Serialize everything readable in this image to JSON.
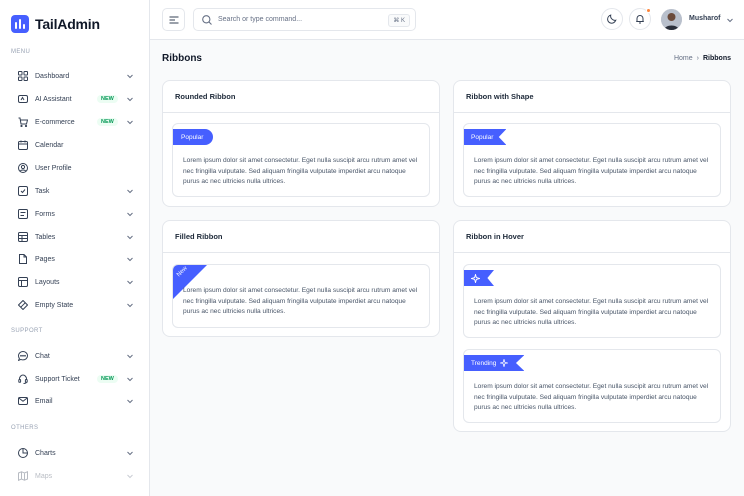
{
  "app": {
    "name": "TailAdmin"
  },
  "colors": {
    "accent": "#465fff",
    "badge_green": "#039855",
    "notif": "#fd853a"
  },
  "sidebar": {
    "sections": [
      {
        "label": "MENU"
      },
      {
        "label": "SUPPORT"
      },
      {
        "label": "OTHERS"
      }
    ],
    "items": [
      {
        "label": "Dashboard",
        "icon": "grid-icon",
        "chevron": true
      },
      {
        "label": "AI Assistant",
        "icon": "ai-icon",
        "badge": "NEW",
        "chevron": true
      },
      {
        "label": "E-commerce",
        "icon": "cart-icon",
        "badge": "NEW",
        "chevron": true
      },
      {
        "label": "Calendar",
        "icon": "calendar-icon"
      },
      {
        "label": "User Profile",
        "icon": "user-circle-icon"
      },
      {
        "label": "Task",
        "icon": "task-icon",
        "chevron": true
      },
      {
        "label": "Forms",
        "icon": "forms-icon",
        "chevron": true
      },
      {
        "label": "Tables",
        "icon": "table-icon",
        "chevron": true
      },
      {
        "label": "Pages",
        "icon": "pages-icon",
        "chevron": true
      },
      {
        "label": "Layouts",
        "icon": "layout-icon",
        "chevron": true
      },
      {
        "label": "Empty State",
        "icon": "empty-state-icon",
        "chevron": true
      },
      {
        "label": "Chat",
        "icon": "chat-icon",
        "chevron": true
      },
      {
        "label": "Support Ticket",
        "icon": "headset-icon",
        "badge": "NEW",
        "chevron": true
      },
      {
        "label": "Email",
        "icon": "mail-icon",
        "chevron": true
      },
      {
        "label": "Charts",
        "icon": "pie-chart-icon",
        "chevron": true
      },
      {
        "label": "Maps",
        "icon": "map-icon",
        "chevron": true
      }
    ]
  },
  "header": {
    "search_placeholder": "Search or type command...",
    "shortcut": "⌘ K",
    "user_name": "Musharof"
  },
  "page": {
    "title": "Ribbons",
    "breadcrumb_home": "Home",
    "breadcrumb_sep": "›",
    "breadcrumb_current": "Ribbons"
  },
  "cards": {
    "rounded": {
      "title": "Rounded Ribbon",
      "ribbon": "Popular"
    },
    "shape": {
      "title": "Ribbon with Shape",
      "ribbon": "Popular"
    },
    "filled": {
      "title": "Filled Ribbon",
      "ribbon": "New"
    },
    "hover": {
      "title": "Ribbon in Hover",
      "ribbon2": "Trending"
    }
  },
  "lorem": "Lorem ipsum dolor sit amet consectetur. Eget nulla suscipit arcu rutrum amet vel nec fringilla vulputate. Sed aliquam fringilla vulputate imperdiet arcu natoque purus ac nec ultricies nulla ultrices."
}
